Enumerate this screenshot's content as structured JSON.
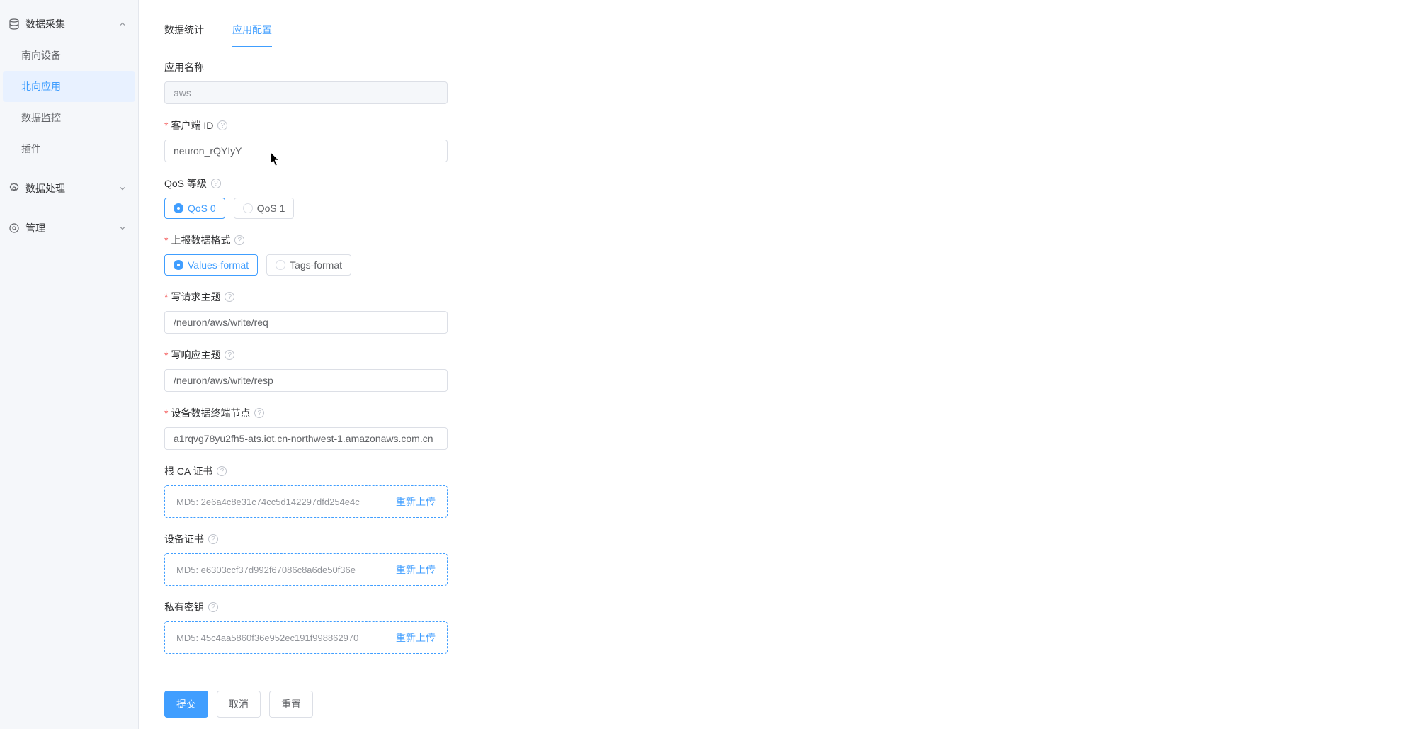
{
  "sidebar": {
    "groups": [
      {
        "label": "数据采集",
        "icon": "database-icon",
        "expanded": true,
        "items": [
          {
            "label": "南向设备",
            "active": false
          },
          {
            "label": "北向应用",
            "active": true
          },
          {
            "label": "数据监控",
            "active": false
          },
          {
            "label": "插件",
            "active": false
          }
        ]
      },
      {
        "label": "数据处理",
        "icon": "gear-icon",
        "expanded": false,
        "items": []
      },
      {
        "label": "管理",
        "icon": "settings-icon",
        "expanded": false,
        "items": []
      }
    ]
  },
  "tabs": [
    {
      "label": "数据统计",
      "active": false
    },
    {
      "label": "应用配置",
      "active": true
    }
  ],
  "form": {
    "app_name": {
      "label": "应用名称",
      "value": "aws",
      "required": false
    },
    "client_id": {
      "label": "客户端 ID",
      "value": "neuron_rQYIyY",
      "required": true
    },
    "qos": {
      "label": "QoS 等级",
      "required": false,
      "options": [
        {
          "label": "QoS 0",
          "selected": true
        },
        {
          "label": "QoS 1",
          "selected": false
        }
      ]
    },
    "format": {
      "label": "上报数据格式",
      "required": true,
      "options": [
        {
          "label": "Values-format",
          "selected": true
        },
        {
          "label": "Tags-format",
          "selected": false
        }
      ]
    },
    "write_req_topic": {
      "label": "写请求主题",
      "value": "/neuron/aws/write/req",
      "required": true
    },
    "write_resp_topic": {
      "label": "写响应主题",
      "value": "/neuron/aws/write/resp",
      "required": true
    },
    "endpoint": {
      "label": "设备数据终端节点",
      "value": "a1rqvg78yu2fh5-ats.iot.cn-northwest-1.amazonaws.com.cn",
      "required": true
    },
    "root_ca": {
      "label": "根 CA 证书",
      "md5_label": "MD5: 2e6a4c8e31c74cc5d142297dfd254e4c",
      "reupload_label": "重新上传"
    },
    "device_cert": {
      "label": "设备证书",
      "md5_label": "MD5: e6303ccf37d992f67086c8a6de50f36e",
      "reupload_label": "重新上传"
    },
    "private_key": {
      "label": "私有密钥",
      "md5_label": "MD5: 45c4aa5860f36e952ec191f998862970",
      "reupload_label": "重新上传"
    }
  },
  "footer": {
    "submit_label": "提交",
    "cancel_label": "取消",
    "reset_label": "重置"
  },
  "accent_color": "#409eff"
}
